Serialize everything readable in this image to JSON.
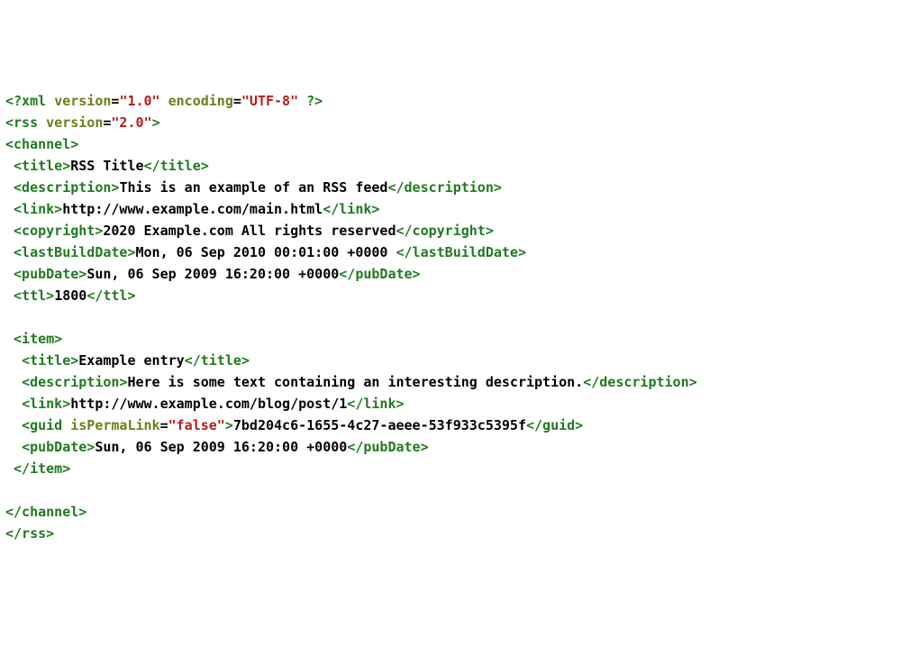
{
  "xml_decl": {
    "open": "<?xml",
    "attr1_name": "version",
    "attr1_val": "\"1.0\"",
    "attr2_name": "encoding",
    "attr2_val": "\"UTF-8\"",
    "close": "?>"
  },
  "rss_open": {
    "open": "<rss",
    "attr_name": "version",
    "attr_val": "\"2.0\"",
    "close": ">"
  },
  "channel_open": "<channel>",
  "title_open": "<title>",
  "title_text": "RSS Title",
  "title_close": "</title>",
  "desc_open": "<description>",
  "desc_text": "This is an example of an RSS feed",
  "desc_close": "</description>",
  "link_open": "<link>",
  "link_text": "http://www.example.com/main.html",
  "link_close": "</link>",
  "copy_open": "<copyright>",
  "copy_text": "2020 Example.com All rights reserved",
  "copy_close": "</copyright>",
  "lbd_open": "<lastBuildDate>",
  "lbd_text": "Mon, 06 Sep 2010 00:01:00 +0000 ",
  "lbd_close": "</lastBuildDate>",
  "pub_open": "<pubDate>",
  "pub_text": "Sun, 06 Sep 2009 16:20:00 +0000",
  "pub_close": "</pubDate>",
  "ttl_open": "<ttl>",
  "ttl_text": "1800",
  "ttl_close": "</ttl>",
  "item_open": "<item>",
  "item_title_open": "<title>",
  "item_title_text": "Example entry",
  "item_title_close": "</title>",
  "item_desc_open": "<description>",
  "item_desc_text": "Here is some text containing an interesting description.",
  "item_desc_close": "</description>",
  "item_link_open": "<link>",
  "item_link_text": "http://www.example.com/blog/post/1",
  "item_link_close": "</link>",
  "guid_open": "<guid",
  "guid_attr_name": "isPermaLink",
  "guid_attr_val": "\"false\"",
  "guid_open_end": ">",
  "guid_text": "7bd204c6-1655-4c27-aeee-53f933c5395f",
  "guid_close": "</guid>",
  "item_pub_open": "<pubDate>",
  "item_pub_text": "Sun, 06 Sep 2009 16:20:00 +0000",
  "item_pub_close": "</pubDate>",
  "item_close": "</item>",
  "channel_close": "</channel>",
  "rss_close": "</rss>"
}
